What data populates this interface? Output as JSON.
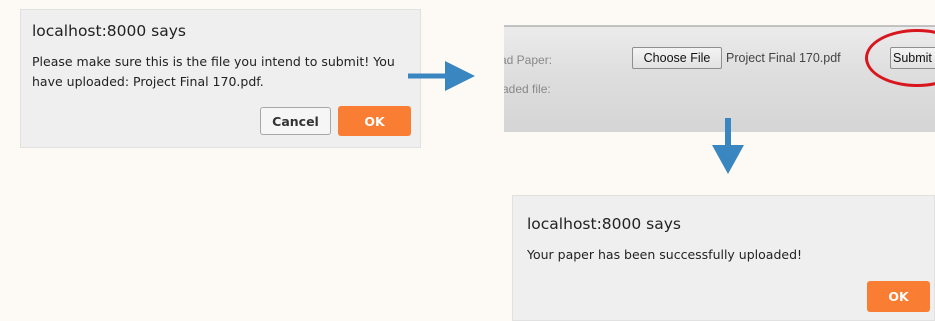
{
  "colors": {
    "page_background": "#fdf9f4",
    "dialog_background": "#efefef",
    "ok_button": "#f97d32",
    "arrow": "#3a86c0",
    "highlight_circle": "#d8161e"
  },
  "confirm_dialog": {
    "title": "localhost:8000 says",
    "message": "Please make sure this is the file you intend to submit! You have uploaded: Project Final 170.pdf.",
    "cancel_label": "Cancel",
    "ok_label": "OK"
  },
  "arrows": {
    "first_icon": "arrow-right-icon",
    "second_icon": "arrow-down-icon"
  },
  "upload_form": {
    "paper_label": "ad Paper:",
    "uploaded_label": "aded file:",
    "choose_file_label": "Choose File",
    "file_name": "Project Final 170.pdf",
    "submit_label": "Submit"
  },
  "success_dialog": {
    "title": "localhost:8000 says",
    "message": "Your paper has been successfully uploaded!",
    "ok_label": "OK"
  }
}
